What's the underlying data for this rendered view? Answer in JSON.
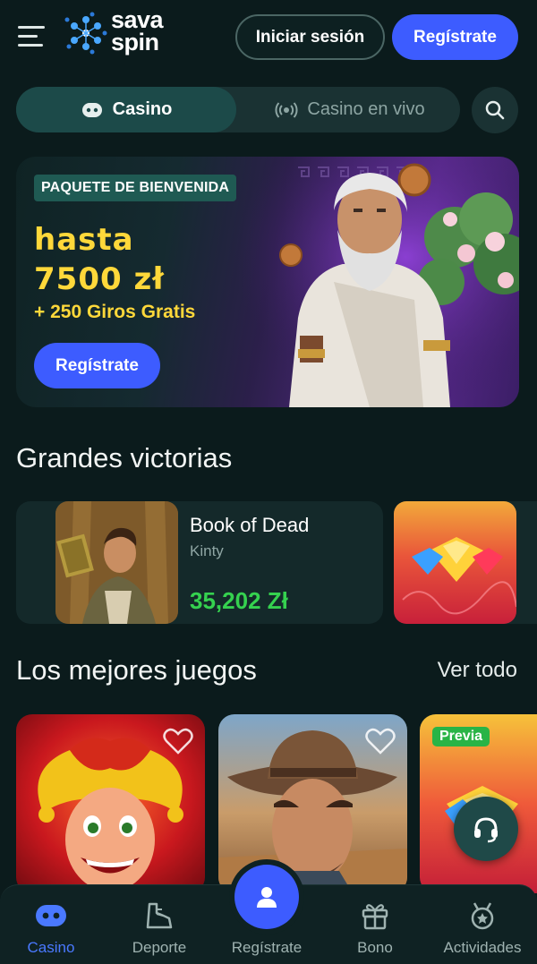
{
  "header": {
    "logo_line1": "sava",
    "logo_line2": "spin",
    "login_label": "Iniciar sesión",
    "register_label": "Regístrate"
  },
  "mode_tabs": [
    {
      "label": "Casino",
      "icon": "robot-icon",
      "active": true
    },
    {
      "label": "Casino en vivo",
      "icon": "live-broadcast-icon",
      "active": false
    }
  ],
  "promo": {
    "badge": "PAQUETE DE BIENVENIDA",
    "line1": "hasta",
    "line2": "7500 zł",
    "spins": "+ 250 Giros Gratis",
    "button_label": "Regístrate"
  },
  "wins": {
    "title": "Grandes victorias",
    "items": [
      {
        "game": "Book of Dead",
        "user": "Kinty",
        "amount": "35,202 Zł"
      }
    ]
  },
  "games": {
    "title": "Los mejores juegos",
    "see_all": "Ver todo",
    "items": [
      {
        "name": "joker",
        "badge": ""
      },
      {
        "name": "cowboy",
        "badge": ""
      },
      {
        "name": "diamonds",
        "badge": "Previa"
      }
    ]
  },
  "bottom_nav": {
    "items": [
      {
        "label": "Casino",
        "icon": "robot-icon",
        "active": true
      },
      {
        "label": "Deporte",
        "icon": "sports-shoe-icon",
        "active": false
      },
      {
        "label": "Regístrate",
        "icon": "user-icon",
        "active": false
      },
      {
        "label": "Bono",
        "icon": "gift-icon",
        "active": false
      },
      {
        "label": "Actividades",
        "icon": "award-icon",
        "active": false
      }
    ]
  },
  "colors": {
    "background": "#0b1b1c",
    "accent_blue": "#3d5cff",
    "promo_yellow": "#ffd83a",
    "win_green": "#35d14f"
  }
}
